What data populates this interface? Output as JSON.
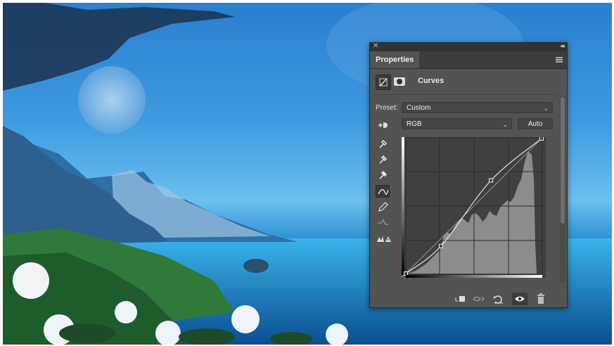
{
  "panel": {
    "title": "Properties",
    "header_title": "Curves",
    "preset_label": "Preset:",
    "preset_value": "Custom",
    "channel_value": "RGB",
    "auto_label": "Auto"
  },
  "icons": {
    "close": "close-icon",
    "collapse": "collapse-icon",
    "panel_menu": "panel-menu-icon",
    "adjustment": "curves-adjustment-icon",
    "mask": "layer-mask-icon",
    "tools": [
      "on-image-adjust-icon",
      "black-point-eyedropper-icon",
      "gray-point-eyedropper-icon",
      "white-point-eyedropper-icon",
      "curve-point-icon",
      "pencil-draw-icon",
      "smooth-curve-icon",
      "clipping-warning-icon"
    ],
    "footer": [
      "clip-to-layer-icon",
      "view-previous-icon",
      "reset-icon",
      "visibility-icon",
      "delete-icon"
    ]
  },
  "curve": {
    "channel": "RGB",
    "points": [
      [
        0,
        0
      ],
      [
        66,
        52
      ],
      [
        160,
        176
      ],
      [
        255,
        255
      ]
    ]
  }
}
